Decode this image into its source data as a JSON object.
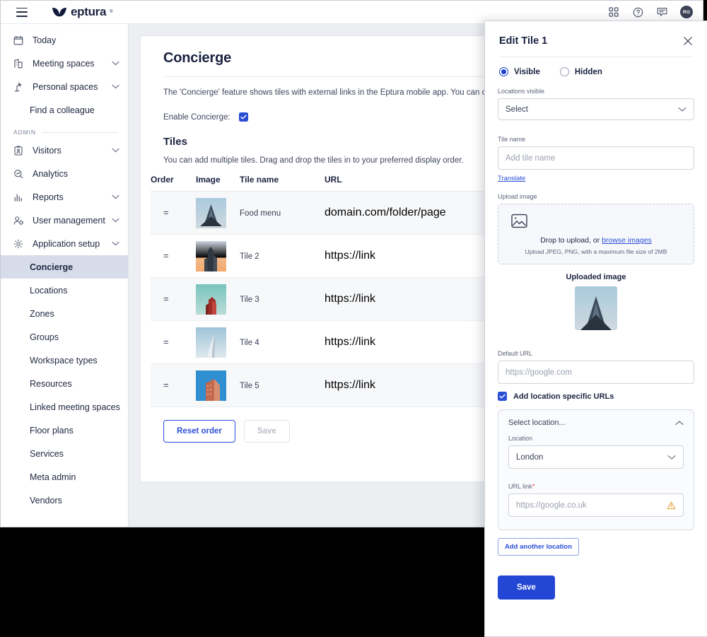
{
  "topbar": {
    "menu_icon": "hamburger-icon",
    "brand": "eptura",
    "brand_tm": "®",
    "apps_icon": "grid-apps-icon",
    "help_icon": "help-circle-icon",
    "feedback_icon": "chat-bubble-icon",
    "avatar_initials": "RO"
  },
  "sidebar": {
    "items": [
      {
        "label": "Today",
        "icon": "calendar-icon",
        "chevron": false
      },
      {
        "label": "Meeting spaces",
        "icon": "building-icon",
        "chevron": true
      },
      {
        "label": "Personal spaces",
        "icon": "desk-lamp-icon",
        "chevron": true
      }
    ],
    "find_colleague": "Find a colleague",
    "admin_label": "ADMIN",
    "admin_items": [
      {
        "label": "Visitors",
        "icon": "badge-icon",
        "chevron": true
      },
      {
        "label": "Analytics",
        "icon": "analytics-search-icon",
        "chevron": false
      },
      {
        "label": "Reports",
        "icon": "bar-chart-icon",
        "chevron": true
      },
      {
        "label": "User management",
        "icon": "user-gear-icon",
        "chevron": true
      },
      {
        "label": "Application setup",
        "icon": "gear-icon",
        "chevron": true
      }
    ],
    "sub_items": [
      {
        "label": "Concierge",
        "active": true
      },
      {
        "label": "Locations",
        "active": false
      },
      {
        "label": "Zones",
        "active": false
      },
      {
        "label": "Groups",
        "active": false
      },
      {
        "label": "Workspace types",
        "active": false
      },
      {
        "label": "Resources",
        "active": false
      },
      {
        "label": "Linked meeting spaces",
        "active": false
      },
      {
        "label": "Floor plans",
        "active": false
      },
      {
        "label": "Services",
        "active": false
      },
      {
        "label": "Meta admin",
        "active": false
      },
      {
        "label": "Vendors",
        "active": false
      }
    ]
  },
  "main": {
    "page_title": "Concierge",
    "description": "The 'Concierge' feature shows tiles with external links in the Eptura mobile app. You can customize these tiles.",
    "enable_label": "Enable Concierge:",
    "enable_checked": true,
    "tiles_heading": "Tiles",
    "tiles_sub": "You can add multiple tiles. Drag and drop the tiles in to your preferred display order.",
    "columns": [
      "Order",
      "Image",
      "Tile name",
      "URL"
    ],
    "rows": [
      {
        "order": "=",
        "image": "building-thumb-1",
        "name": "Food menu",
        "url": "domain.com/folder/page"
      },
      {
        "order": "=",
        "image": "building-thumb-2",
        "name": "Tile 2",
        "url": "https://link"
      },
      {
        "order": "=",
        "image": "building-thumb-3",
        "name": "Tile 3",
        "url": "https://link"
      },
      {
        "order": "=",
        "image": "building-thumb-4",
        "name": "Tile 4",
        "url": "https://link"
      },
      {
        "order": "=",
        "image": "building-thumb-5",
        "name": "Tile 5",
        "url": "https://link"
      }
    ],
    "reset_button": "Reset order",
    "save_button": "Save"
  },
  "drawer": {
    "title": "Edit Tile 1",
    "close_icon": "close-x-icon",
    "visibility": {
      "visible_label": "Visible",
      "hidden_label": "Hidden",
      "selected": "Visible"
    },
    "locations_visible": {
      "label": "Locations visible",
      "value": "Select"
    },
    "tile_name": {
      "label": "Tile name",
      "placeholder": "Add tile name",
      "value": ""
    },
    "translate_link": "Translate",
    "upload": {
      "label": "Upload image",
      "icon": "image-placeholder-icon",
      "drop_text": "Drop to upload, or ",
      "browse_link": "browse images",
      "hint": "Upload JPEG, PNG, with a maximum file size of 2MB"
    },
    "uploaded": {
      "label": "Uploaded image",
      "image": "building-thumb-1"
    },
    "default_url": {
      "label": "Default URL",
      "placeholder": "https://google.com",
      "value": ""
    },
    "add_location_urls": {
      "label": "Add location specific URLs",
      "checked": true
    },
    "location_block": {
      "header": "Select location...",
      "collapse_icon": "chevron-up-icon",
      "location_label": "Location",
      "location_value": "London",
      "url_label": "URL link",
      "url_required_mark": "*",
      "url_placeholder": "https://google.co.uk",
      "warning_icon": "warning-triangle-icon"
    },
    "add_another_location": "Add another location",
    "save_button": "Save"
  },
  "colors": {
    "brand_navy": "#1b2240",
    "primary_blue": "#2346d4",
    "accent_link": "#2b4ed6",
    "active_nav_bg": "#d6dce9",
    "warning": "#e8a33d",
    "required": "#d1344b",
    "page_bg": "#eceef1"
  }
}
